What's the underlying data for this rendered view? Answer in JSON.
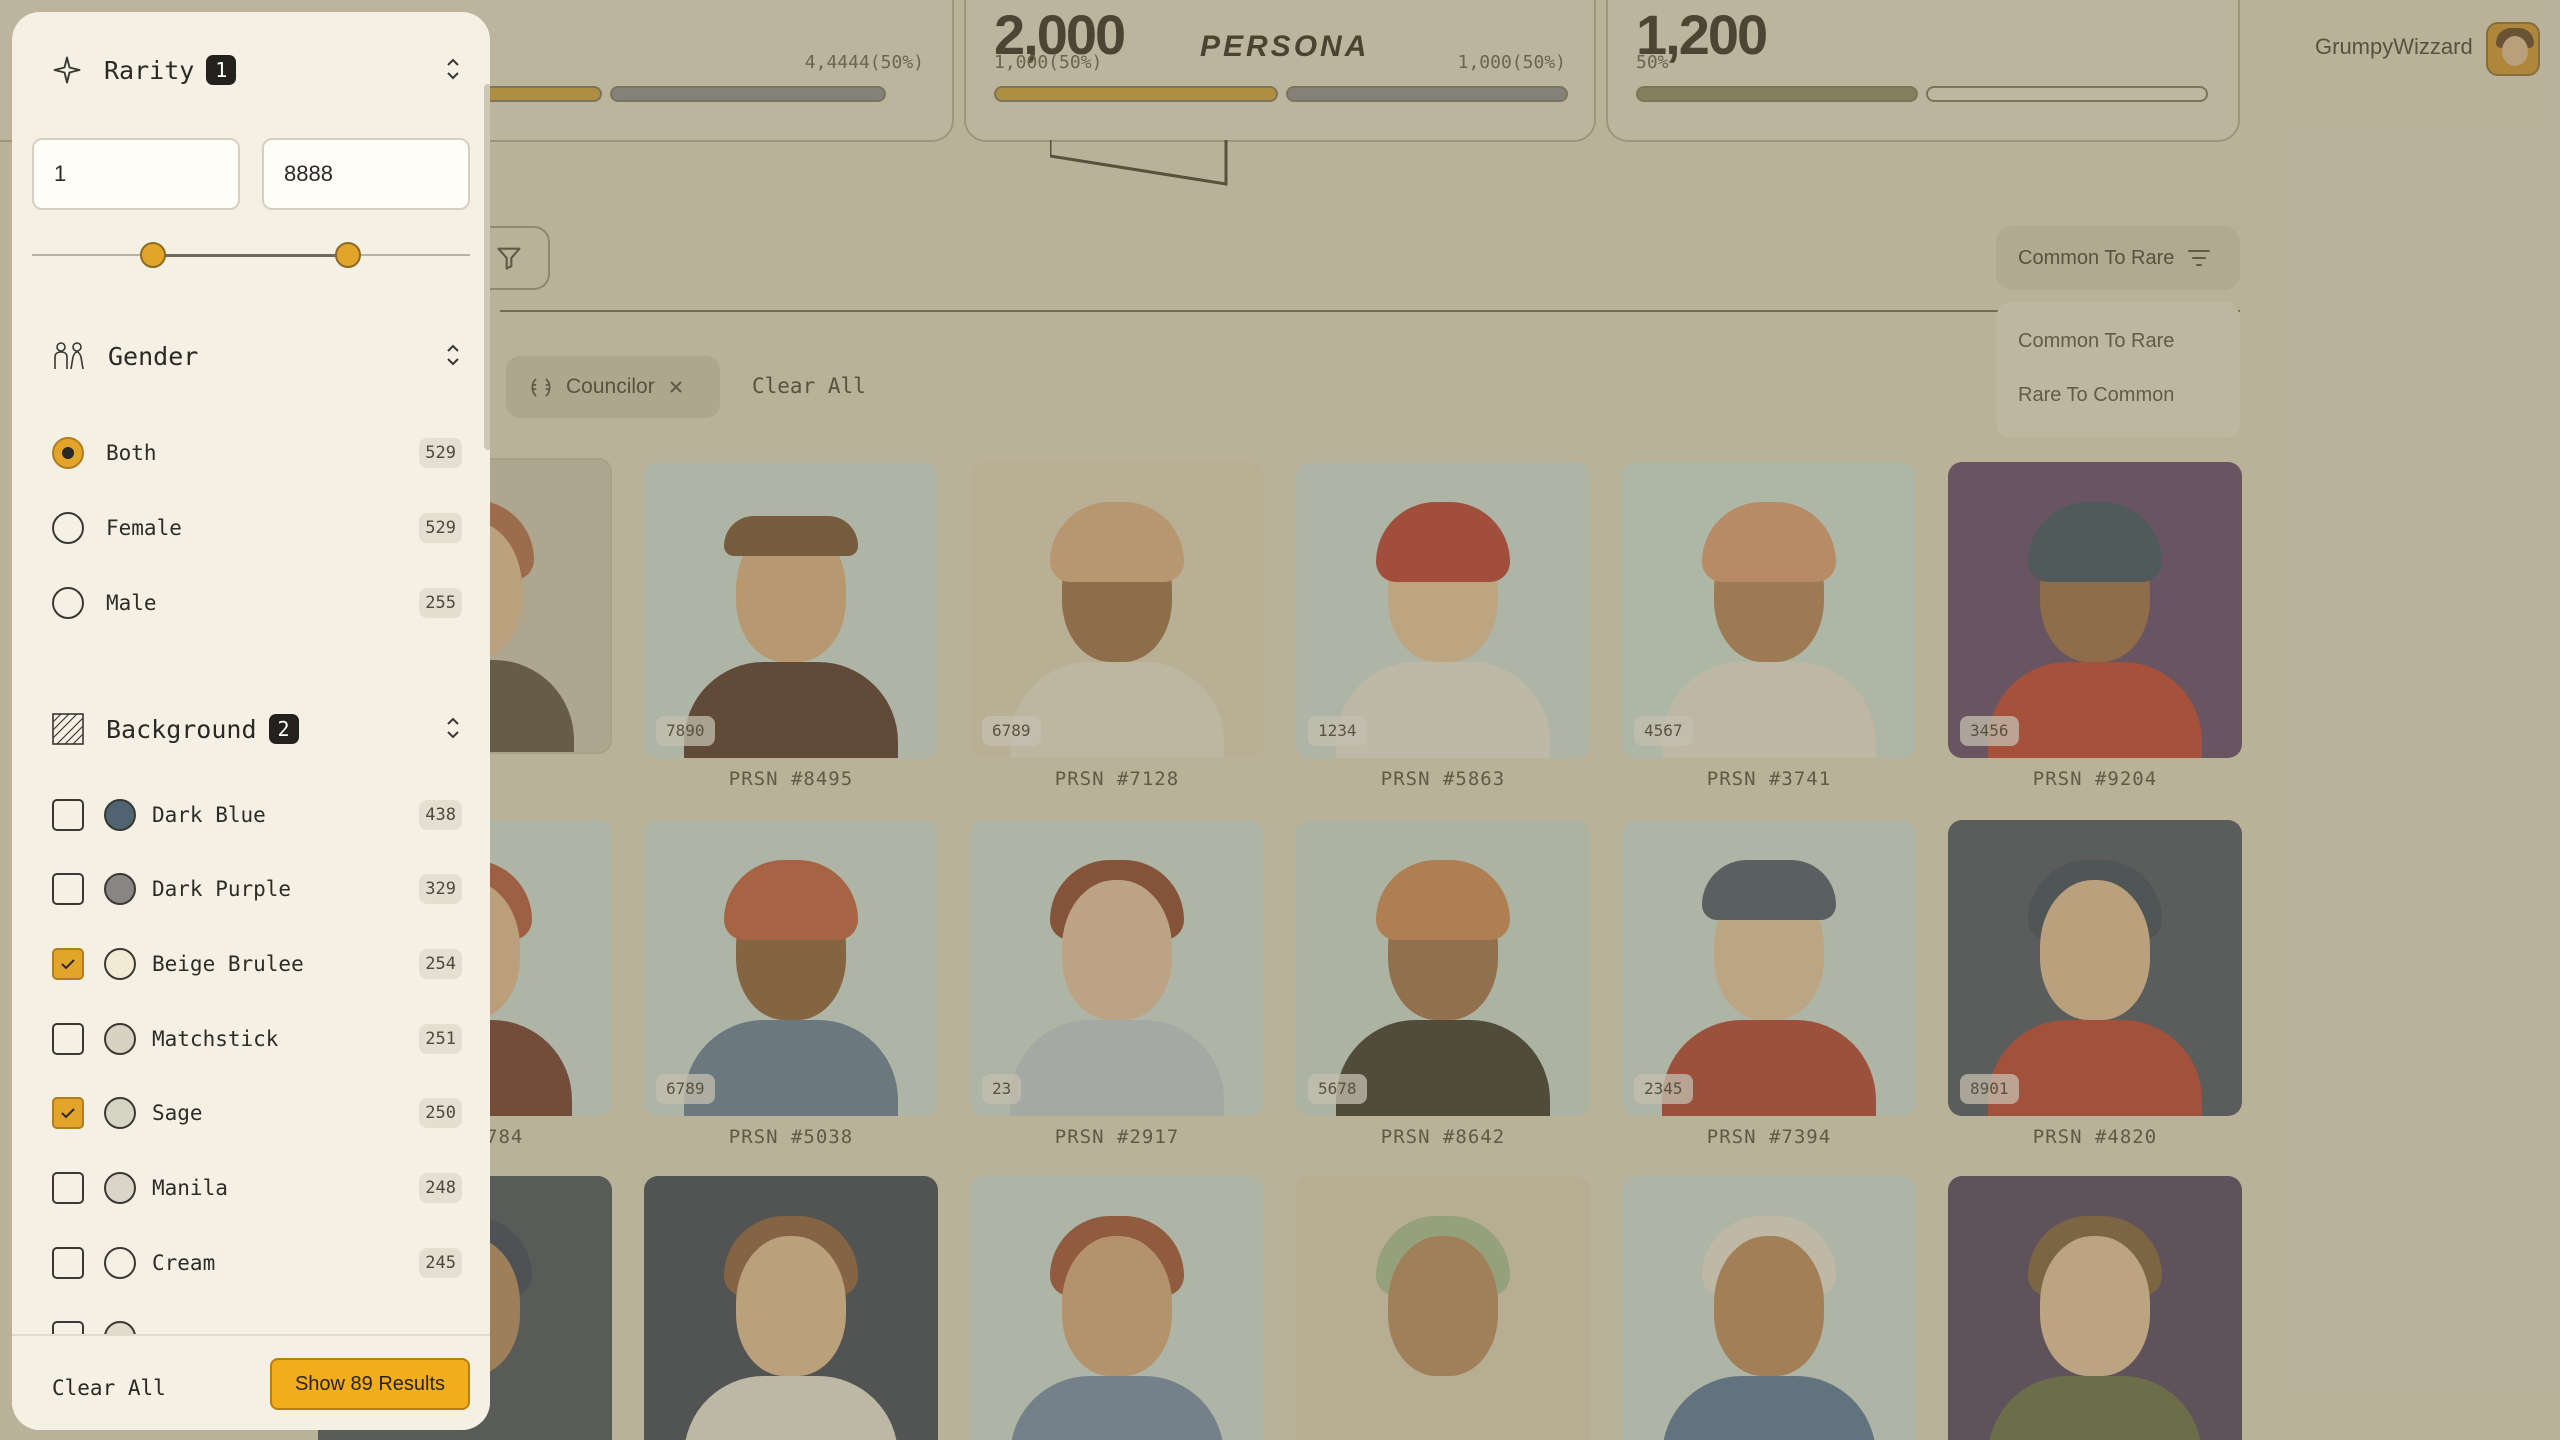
{
  "stats": [
    {
      "value": "",
      "sub_left": "",
      "sub_right": "4,4444(50%)"
    },
    {
      "value": "2,000",
      "sub_left": "1,000(50%)",
      "sub_right": "1,000(50%)",
      "logo": "PERSONA"
    },
    {
      "value": "1,200",
      "sub_left": "50%",
      "sub_right": ""
    }
  ],
  "user": {
    "name": "GrumpyWizzard"
  },
  "sort": {
    "label": "Common To Rare",
    "options": [
      "Common To Rare",
      "Rare To Common"
    ]
  },
  "active_filters": {
    "chip": "Councilor",
    "clear_all": "Clear All"
  },
  "cards": [
    {
      "num": "",
      "label": "347"
    },
    {
      "num": "7890",
      "label": "PRSN #8495"
    },
    {
      "num": "6789",
      "label": "PRSN #7128"
    },
    {
      "num": "1234",
      "label": "PRSN #5863"
    },
    {
      "num": "4567",
      "label": "PRSN #3741"
    },
    {
      "num": "3456",
      "label": "PRSN #9204"
    },
    {
      "num": "",
      "label": "784"
    },
    {
      "num": "6789",
      "label": "PRSN #5038"
    },
    {
      "num": "23",
      "label": "PRSN #2917"
    },
    {
      "num": "5678",
      "label": "PRSN #8642"
    },
    {
      "num": "2345",
      "label": "PRSN #7394"
    },
    {
      "num": "8901",
      "label": "PRSN #4820"
    }
  ],
  "drawer": {
    "rarity": {
      "title": "Rarity",
      "badge": "1",
      "min": "1",
      "max": "8888"
    },
    "gender": {
      "title": "Gender",
      "options": [
        {
          "label": "Both",
          "count": "529",
          "selected": true
        },
        {
          "label": "Female",
          "count": "529",
          "selected": false
        },
        {
          "label": "Male",
          "count": "255",
          "selected": false
        }
      ]
    },
    "background": {
      "title": "Background",
      "badge": "2",
      "options": [
        {
          "label": "Dark Blue",
          "count": "438",
          "checked": false,
          "color": "#4f6470"
        },
        {
          "label": "Dark Purple",
          "count": "329",
          "checked": false,
          "color": "#8a8585"
        },
        {
          "label": "Beige Brulee",
          "count": "254",
          "checked": true,
          "color": "#f2ead4"
        },
        {
          "label": "Matchstick",
          "count": "251",
          "checked": false,
          "color": "#d8d2c3"
        },
        {
          "label": "Sage",
          "count": "250",
          "checked": true,
          "color": "#d6d4c4"
        },
        {
          "label": "Manila",
          "count": "248",
          "checked": false,
          "color": "#d9d5c8"
        },
        {
          "label": "Cream",
          "count": "245",
          "checked": false,
          "color": "#f4f0e4"
        }
      ]
    },
    "footer": {
      "clear_all": "Clear All",
      "show_results": "Show 89 Results"
    }
  },
  "colors": {
    "accent": "#f1ad1c",
    "overlay": "rgba(125,112,78,0.45)"
  }
}
